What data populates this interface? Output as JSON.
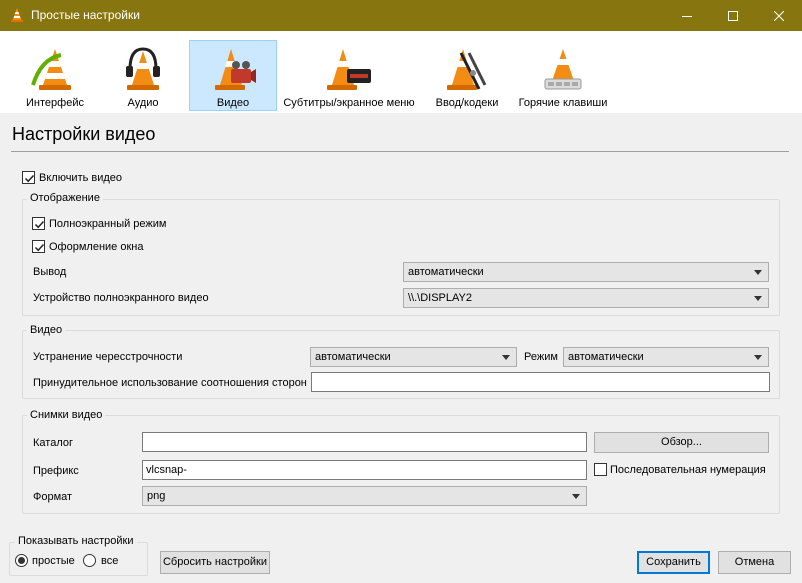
{
  "window": {
    "title": "Простые настройки",
    "icons": {
      "app": "vlc-cone-icon",
      "minimize": "minimize-icon",
      "maximize": "maximize-icon",
      "close": "close-icon"
    }
  },
  "toolbar": {
    "items": [
      {
        "label": "Интерфейс",
        "icon": "interface-cone-icon"
      },
      {
        "label": "Аудио",
        "icon": "headphones-cone-icon"
      },
      {
        "label": "Видео",
        "icon": "video-cone-icon",
        "selected": true
      },
      {
        "label": "Субтитры/экранное меню",
        "icon": "subtitles-cone-icon"
      },
      {
        "label": "Ввод/кодеки",
        "icon": "codecs-cone-icon"
      },
      {
        "label": "Горячие клавиши",
        "icon": "hotkeys-cone-icon"
      }
    ]
  },
  "page": {
    "title": "Настройки видео"
  },
  "enable_video": {
    "label": "Включить видео",
    "checked": true
  },
  "display": {
    "title": "Отображение",
    "fullscreen": {
      "label": "Полноэкранный режим",
      "checked": true
    },
    "decorations": {
      "label": "Оформление окна",
      "checked": true
    },
    "output": {
      "label": "Вывод",
      "value": "автоматически"
    },
    "fullscreen_device": {
      "label": "Устройство полноэкранного видео",
      "value": "\\\\.\\DISPLAY2"
    }
  },
  "video": {
    "title": "Видео",
    "deinterlace": {
      "label": "Устранение чересстрочности",
      "value": "автоматически"
    },
    "mode": {
      "label": "Режим",
      "value": "автоматически"
    },
    "aspect": {
      "label": "Принудительное использование соотношения сторон",
      "value": ""
    }
  },
  "snapshots": {
    "title": "Снимки видео",
    "directory": {
      "label": "Каталог",
      "value": ""
    },
    "browse_label": "Обзор...",
    "prefix": {
      "label": "Префикс",
      "value": "vlcsnap-"
    },
    "sequential": {
      "label": "Последовательная нумерация",
      "checked": false
    },
    "format": {
      "label": "Формат",
      "value": "png"
    }
  },
  "show_settings": {
    "title": "Показывать настройки",
    "options": [
      {
        "label": "простые",
        "selected": true
      },
      {
        "label": "все",
        "selected": false
      }
    ]
  },
  "buttons": {
    "reset": "Сбросить настройки",
    "save": "Сохранить",
    "cancel": "Отмена"
  },
  "colors": {
    "titlebar": "#87750f",
    "selected_tab": "#cce8ff",
    "accent": "#0078d7",
    "cone": "#f28c13"
  }
}
